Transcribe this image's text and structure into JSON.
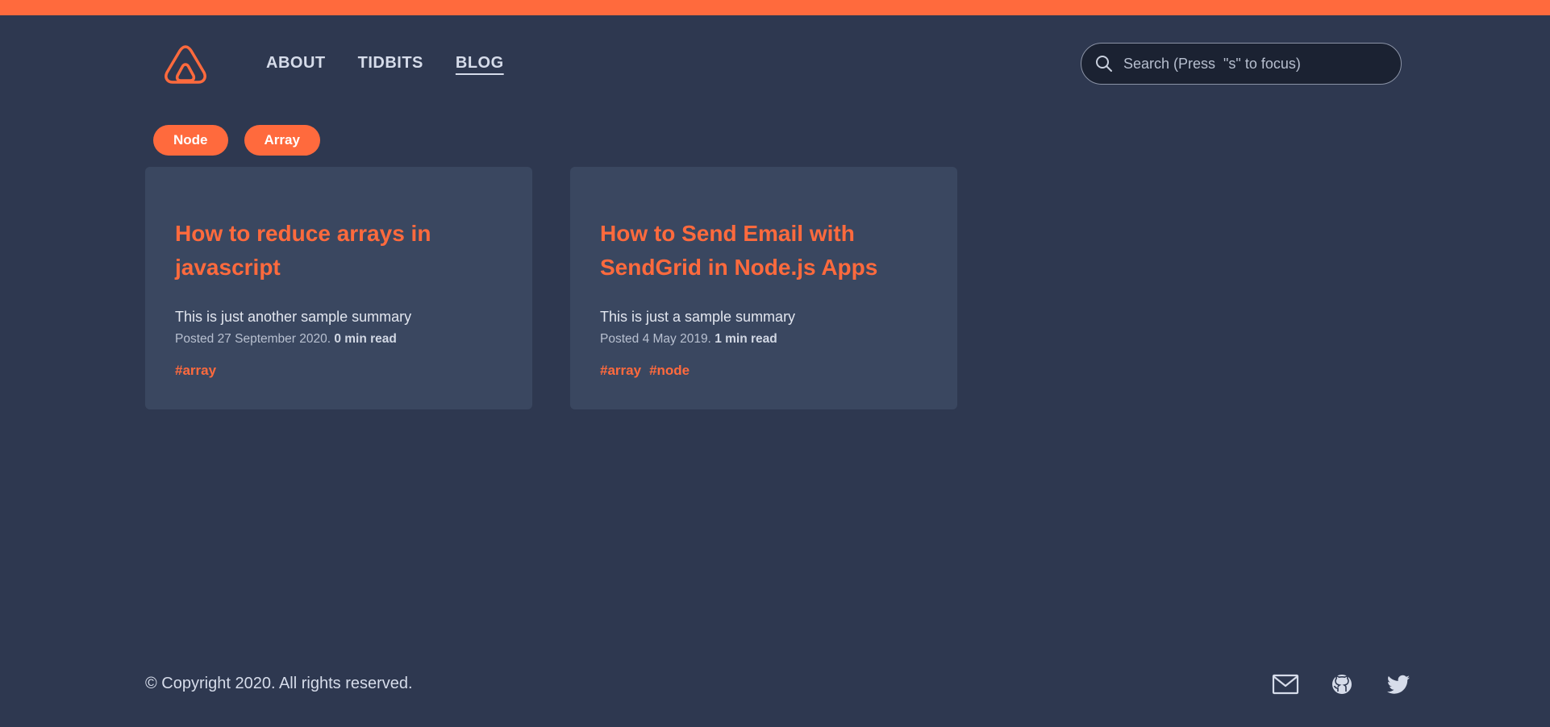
{
  "colors": {
    "accent": "#ff6a3d",
    "background": "#2e3850",
    "card": "#3a4760",
    "search_bg": "#1b2232",
    "text": "#d6dcea"
  },
  "header": {
    "logo_icon": "mountain-triangle-logo-icon",
    "nav": [
      {
        "label": "ABOUT",
        "active": false
      },
      {
        "label": "TIDBITS",
        "active": false
      },
      {
        "label": "BLOG",
        "active": true
      }
    ],
    "search": {
      "icon": "search-icon",
      "placeholder": "Search (Press  \"s\" to focus)",
      "value": ""
    }
  },
  "filter_tags": [
    "Node",
    "Array"
  ],
  "posts": [
    {
      "title": "How to reduce arrays in javascript",
      "summary": "This is just another sample summary",
      "posted_prefix": "Posted ",
      "date": "27 September 2020.",
      "read_time": "0 min read",
      "tags": [
        "#array"
      ]
    },
    {
      "title": "How to Send Email with SendGrid in Node.js Apps",
      "summary": "This is just a sample summary",
      "posted_prefix": "Posted ",
      "date": "4 May 2019.",
      "read_time": "1 min read",
      "tags": [
        "#array",
        "#node"
      ]
    }
  ],
  "footer": {
    "copyright": "© Copyright 2020. All rights reserved.",
    "social_icons": [
      "mail-icon",
      "github-icon",
      "twitter-icon"
    ]
  }
}
